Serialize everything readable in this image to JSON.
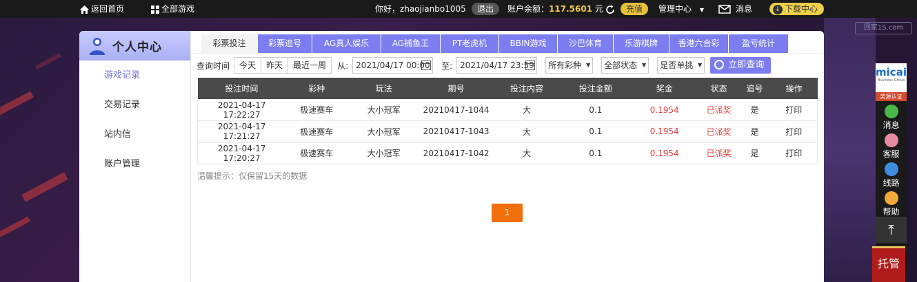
{
  "topbar": {
    "home_label": "返回首页",
    "all_games_label": "全部游戏",
    "greeting": "你好，zhaojianbo1005",
    "logout_label": "退出",
    "balance_label": "账户余额：",
    "balance_value": "117.5601",
    "balance_unit": "元",
    "recharge_label": "充值",
    "manage_label": "管理中心",
    "messages_label": "消息",
    "download_label": "下载中心"
  },
  "sidebar": {
    "title": "个人中心",
    "items": [
      {
        "label": "游戏记录"
      },
      {
        "label": "交易记录"
      },
      {
        "label": "站内信"
      },
      {
        "label": "账户管理"
      }
    ]
  },
  "tabs": [
    {
      "label": "彩票投注"
    },
    {
      "label": "彩票追号"
    },
    {
      "label": "AG真人娱乐"
    },
    {
      "label": "AG捕鱼王"
    },
    {
      "label": "PT老虎机"
    },
    {
      "label": "BBIN游戏"
    },
    {
      "label": "沙巴体育"
    },
    {
      "label": "乐游棋牌"
    },
    {
      "label": "香港六合彩"
    },
    {
      "label": "盈亏统计"
    }
  ],
  "filters": {
    "query_time_label": "查询时间",
    "quick": [
      "今天",
      "昨天",
      "最近一周"
    ],
    "from_label": "从:",
    "from_value": "2021/04/17 00:00",
    "to_label": "至:",
    "to_value": "2021/04/17 23:59",
    "lottery_select": "所有彩种",
    "status_select": "全部状态",
    "single_select": "是否单挑",
    "query_button": "立即查询"
  },
  "table": {
    "headers": [
      "投注时间",
      "彩种",
      "玩法",
      "期号",
      "投注内容",
      "投注金额",
      "奖金",
      "状态",
      "追号",
      "操作"
    ],
    "rows": [
      [
        "2021-04-17 17:22:27",
        "极速赛车",
        "大小冠军",
        "20210417-1044",
        "大",
        "0.1",
        "0.1954",
        "已派奖",
        "是",
        "打印"
      ],
      [
        "2021-04-17 17:21:27",
        "极速赛车",
        "大小冠军",
        "20210417-1043",
        "大",
        "0.1",
        "0.1954",
        "已派奖",
        "是",
        "打印"
      ],
      [
        "2021-04-17 17:20:27",
        "极速赛车",
        "大小冠军",
        "20210417-1042",
        "大",
        "0.1",
        "0.1954",
        "已派奖",
        "是",
        "打印"
      ]
    ]
  },
  "tip": "温馨提示：仅保留15天的数据",
  "pager": {
    "current": "1"
  },
  "widget": {
    "logo": "micai",
    "logo_sub": "Business Group",
    "cert": "奖源认证",
    "items": [
      {
        "label": "消息",
        "icon": "chat-icon",
        "color": "#49b84a"
      },
      {
        "label": "客服",
        "icon": "agent-icon",
        "color": "#e88aa0"
      },
      {
        "label": "线路",
        "icon": "speed-icon",
        "color": "#3e8de0"
      },
      {
        "label": "帮助",
        "icon": "help-icon",
        "color": "#f0a838"
      }
    ],
    "host_label": "托管"
  },
  "watermark": "回家1S.com",
  "colors": {
    "accent": "#7b7df0",
    "table_header": "#4a4a4a",
    "prize_red": "#e33c3c",
    "pager_orange": "#f26f0d",
    "balance_gold": "#f2c94c"
  }
}
